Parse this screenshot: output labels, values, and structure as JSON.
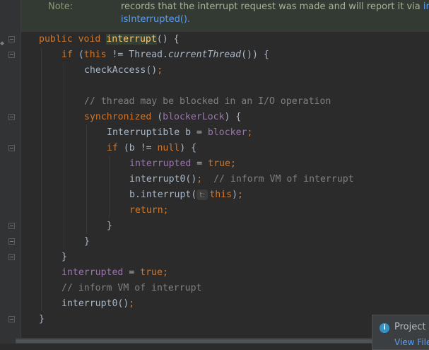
{
  "doc": {
    "note_label": "Note:",
    "line1": "records that the interrupt request was made and will report it via",
    "line1_link": " interr",
    "line2": "isInterrupted()."
  },
  "code": {
    "l1": {
      "kw1": "public",
      "kw2": "void",
      "name": "interrupt",
      "rest": "() {"
    },
    "l2": {
      "kw": "if",
      "p1": " (",
      "this": "this",
      "p2": " != Thread.",
      "call": "currentThread",
      "p3": "()) {"
    },
    "l3": {
      "call": "checkAccess()",
      "semi": ";"
    },
    "l4": {
      "comment": "// thread may be blocked in an I/O operation"
    },
    "l5": {
      "kw": "synchronized",
      "p1": " (",
      "field": "blockerLock",
      "p2": ") {"
    },
    "l6": {
      "p1": "Interruptible b = ",
      "field": "blocker",
      "semi": ";"
    },
    "l7": {
      "kw": "if",
      "p1": " (b != ",
      "null": "null",
      "p2": ") {"
    },
    "l8": {
      "field": "interrupted",
      "p1": " = ",
      "val": "true",
      "semi": ";"
    },
    "l9": {
      "call": "interrupt0()",
      "semi": ";",
      "comment": "  // inform VM of interrupt"
    },
    "l10": {
      "p1": "b.interrupt(",
      "hint": "t:",
      "this": "this",
      "p2": ")",
      "semi": ";"
    },
    "l11": {
      "kw": "return",
      "semi": ";"
    },
    "l12": {
      "brace": "}"
    },
    "l13": {
      "brace": "}"
    },
    "l14": {
      "brace": "}"
    },
    "l15": {
      "field": "interrupted",
      "p1": " = ",
      "val": "true",
      "semi": ";"
    },
    "l16": {
      "comment": "// inform VM of interrupt"
    },
    "l17": {
      "call": "interrupt0()",
      "semi": ";"
    },
    "l18": {
      "brace": "}"
    }
  },
  "toast": {
    "title": "Project c",
    "link": "View File",
    "icon": "info-icon"
  },
  "colors": {
    "background": "#2b2b2b",
    "keyword": "#cc7832",
    "function": "#ffc66d",
    "field": "#9876aa",
    "comment": "#808080",
    "link": "#589df6"
  }
}
